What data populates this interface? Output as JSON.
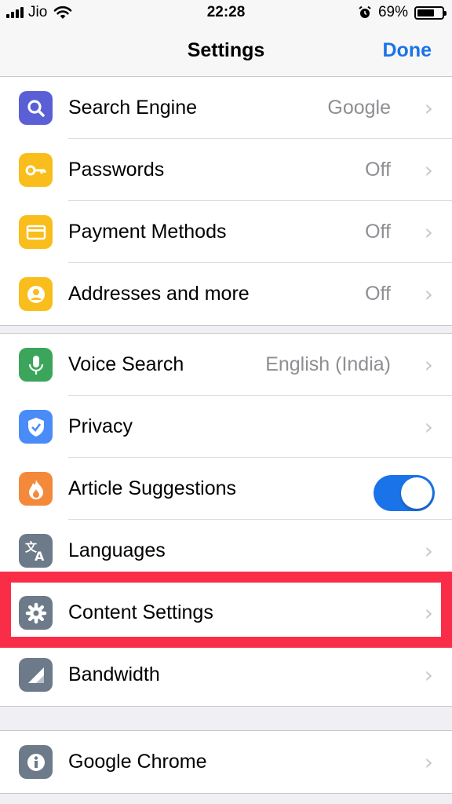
{
  "status": {
    "carrier": "Jio",
    "time": "22:28",
    "battery_percent": "69%",
    "battery_level": 0.69
  },
  "nav": {
    "title": "Settings",
    "done": "Done"
  },
  "groups": [
    [
      {
        "id": "search-engine",
        "label": "Search Engine",
        "value": "Google",
        "icon": "search-icon",
        "color": "#5b5fd6"
      },
      {
        "id": "passwords",
        "label": "Passwords",
        "value": "Off",
        "icon": "key-icon",
        "color": "#f9bd1c"
      },
      {
        "id": "payment-methods",
        "label": "Payment Methods",
        "value": "Off",
        "icon": "credit-card-icon",
        "color": "#f9bd1c"
      },
      {
        "id": "addresses",
        "label": "Addresses and more",
        "value": "Off",
        "icon": "person-icon",
        "color": "#f9bd1c"
      }
    ],
    [
      {
        "id": "voice-search",
        "label": "Voice Search",
        "value": "English (India)",
        "icon": "microphone-icon",
        "color": "#3ba55b"
      },
      {
        "id": "privacy",
        "label": "Privacy",
        "value": "",
        "icon": "shield-check-icon",
        "color": "#4a8cf7"
      },
      {
        "id": "article-suggestions",
        "label": "Article Suggestions",
        "toggle": true,
        "toggle_on": true,
        "icon": "flame-icon",
        "color": "#f4883b"
      },
      {
        "id": "languages",
        "label": "Languages",
        "value": "",
        "icon": "translate-icon",
        "color": "#6c7a89"
      },
      {
        "id": "content-settings",
        "label": "Content Settings",
        "value": "",
        "icon": "gear-icon",
        "color": "#6c7a89"
      },
      {
        "id": "bandwidth",
        "label": "Bandwidth",
        "value": "",
        "icon": "signal-icon",
        "color": "#6c7a89"
      }
    ],
    [
      {
        "id": "google-chrome",
        "label": "Google Chrome",
        "value": "",
        "icon": "info-icon",
        "color": "#6c7a89"
      }
    ]
  ],
  "chevron": "›",
  "highlight_color": "#fa2d48"
}
